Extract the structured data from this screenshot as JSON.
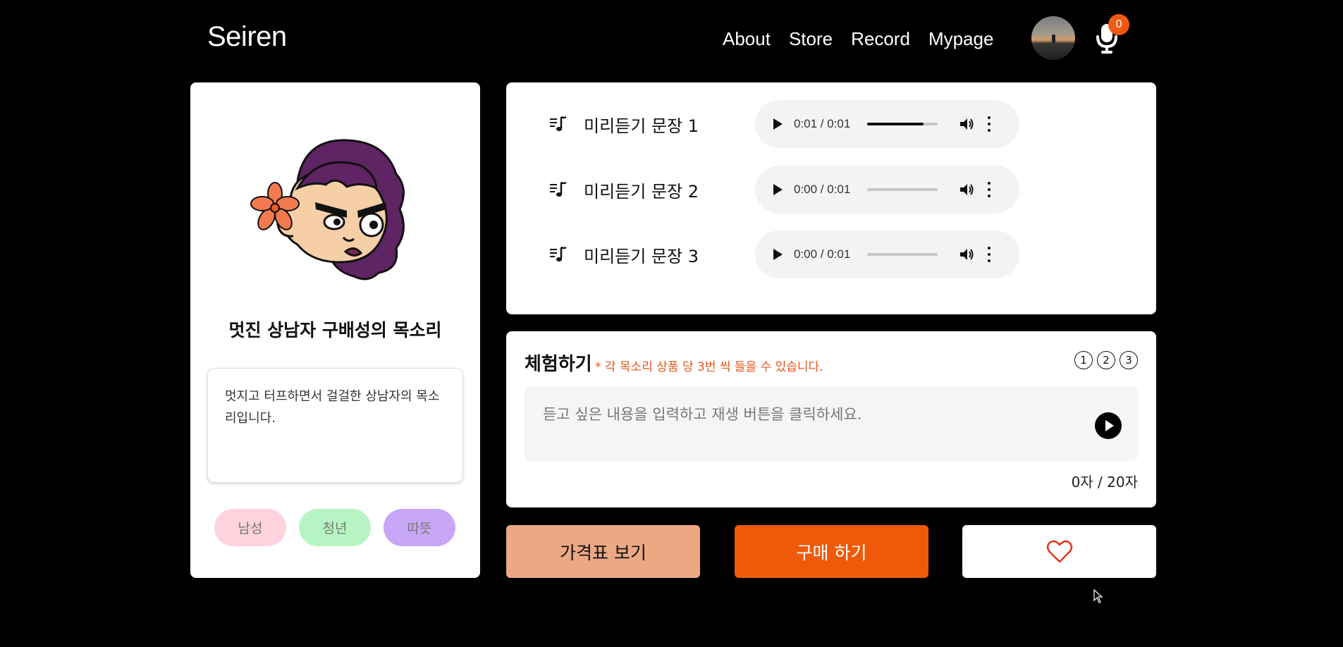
{
  "header": {
    "logo": "Seiren",
    "nav": [
      "About",
      "Store",
      "Record",
      "Mypage"
    ],
    "mic_badge_count": "0",
    "icons": {
      "avatar": "user-avatar",
      "mic": "microphone-icon"
    }
  },
  "profile": {
    "name": "멋진 상남자 구배성의 목소리",
    "description": "멋지고 터프하면서 걸걸한 상남자의 목소리입니다.",
    "tags": [
      {
        "label": "남성",
        "color": "#ffd3de"
      },
      {
        "label": "청년",
        "color": "#b6f5c3"
      },
      {
        "label": "따뜻",
        "color": "#c8a6f7"
      }
    ]
  },
  "samples": [
    {
      "label": "미리듣기 문장 1",
      "time": "0:01 / 0:01",
      "progress": 0.8
    },
    {
      "label": "미리듣기 문장 2",
      "time": "0:00 / 0:01",
      "progress": 0
    },
    {
      "label": "미리듣기 문장 3",
      "time": "0:00 / 0:01",
      "progress": 0
    }
  ],
  "trial": {
    "title": "체험하기",
    "note": "* 각 목소리 상품 당 3번 씩 들을 수 있습니다.",
    "counts": [
      "1",
      "2",
      "3"
    ],
    "placeholder": "듣고 싶은 내용을 입력하고 재생 버튼을 클릭하세요.",
    "char_count": "0자 / 20자"
  },
  "buttons": {
    "price": "가격표 보기",
    "buy": "구매 하기",
    "like_icon": "heart-icon"
  },
  "colors": {
    "accent": "#ef5a0a",
    "price_button": "#eba883",
    "note_text": "#e4551a"
  }
}
